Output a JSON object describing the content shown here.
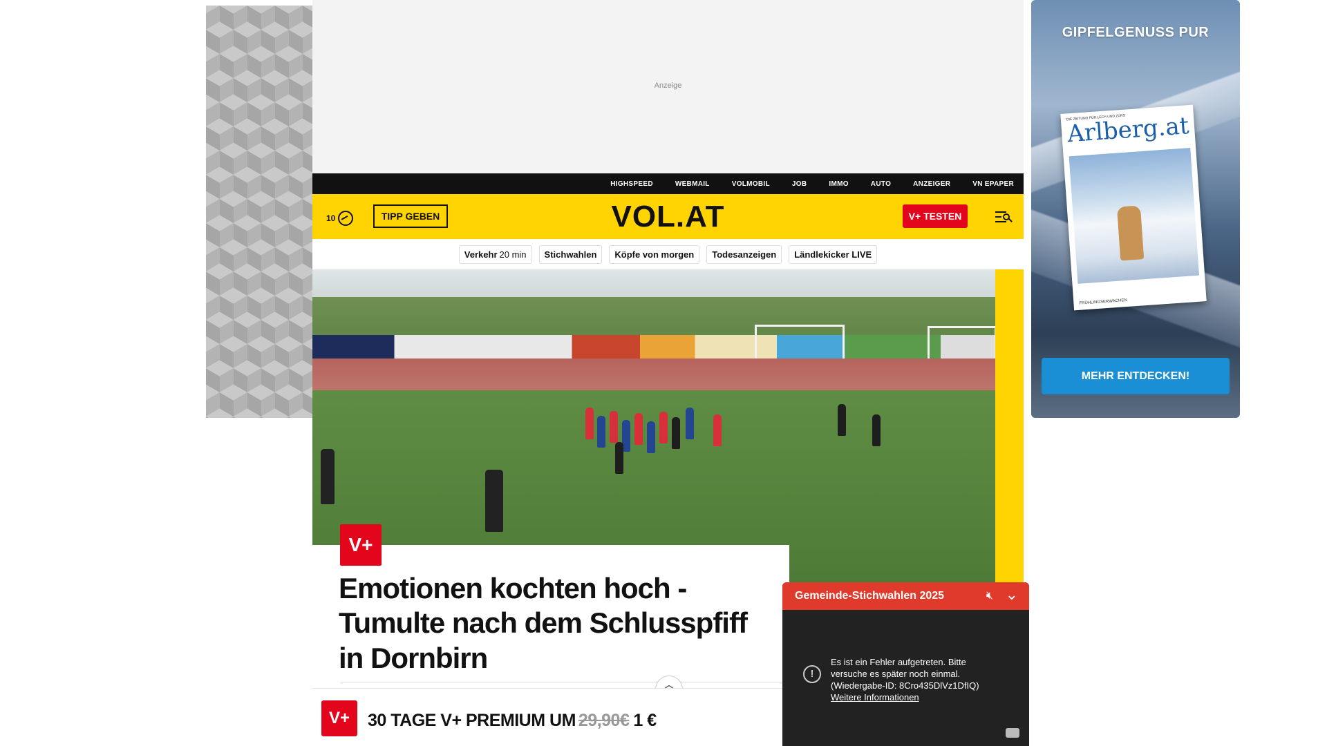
{
  "ad_top": {
    "label": "Anzeige"
  },
  "topnav": {
    "items": [
      "HIGHSPEED",
      "WEBMAIL",
      "VOLMOBIL",
      "JOB",
      "IMMO",
      "AUTO",
      "ANZEIGER",
      "VN EPAPER"
    ]
  },
  "header": {
    "weather_temp": "10",
    "weather_icon": "weather-icon",
    "tipp_label": "TIPP GEBEN",
    "logo": "VOL.AT",
    "testen_label": "V+ TESTEN",
    "menu_icon": "menu-search-icon",
    "brand_yellow": "#ffd400",
    "brand_red": "#e3051b"
  },
  "subnav": {
    "verkehr_label": "Verkehr",
    "verkehr_time": "20 min",
    "items": [
      "Stichwahlen",
      "Köpfe von morgen",
      "Todesanzeigen",
      "Ländlekicker LIVE"
    ]
  },
  "article": {
    "badge": "V+",
    "headline": "Emotionen kochten hoch - Tumulte nach dem Schlusspfiff in Dornbirn"
  },
  "promo": {
    "badge": "V+",
    "text": "30 TAGE V+ PREMIUM UM",
    "old_price": "29,90€",
    "new_price": "1 €"
  },
  "ad_right": {
    "title": "GIPFELGENUSS PUR",
    "magazine_top": "DIE ZEITUNG FÜR LECH UND ZÜRS",
    "magazine_name": "Arlberg.at",
    "magazine_bottom": "FRÜHLINGSERWACHEN",
    "button": "MEHR ENTDECKEN!"
  },
  "video": {
    "title": "Gemeinde-Stichwahlen 2025",
    "error_text": "Es ist ein Fehler aufgetreten. Bitte versuche es später noch einmal. (Wiedergabe-ID: 8Cro435DlVz1DfIQ)",
    "more_link": "Weitere Informationen",
    "header_color": "#e03a2c"
  }
}
